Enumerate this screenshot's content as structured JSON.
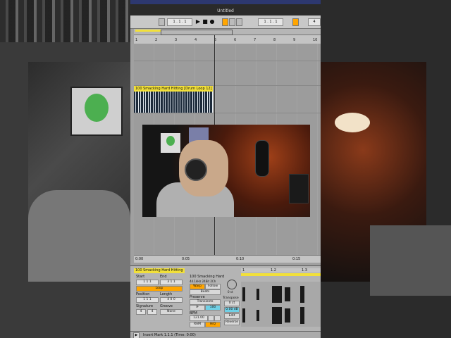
{
  "window": {
    "title": "Untitled"
  },
  "toolbar": {
    "arrangement_position": "1 . 1 . 1",
    "loop_start": "1 . 1 . 1",
    "loop_length": "4"
  },
  "ruler": {
    "ticks": [
      "1",
      "2",
      "3",
      "4",
      "5",
      "6",
      "7",
      "8",
      "9",
      "10"
    ]
  },
  "clip": {
    "name": "100 Smacking Hard Hitting [Drum Loop 12]"
  },
  "time_ruler": {
    "ticks": [
      "0:00",
      "0:05",
      "0:10",
      "0:15"
    ]
  },
  "clip_view": {
    "clip_name": "100 Smacking Hard Hitting",
    "sample_name": "100 Smacking Hard",
    "sample_info": "44.1kHz 24Bit 2Ch",
    "start_label": "Start",
    "end_label": "End",
    "start_value": "1  1  1",
    "end_value": "3  1  1",
    "loop_label": "Loop",
    "position_label": "Position",
    "length_label": "Length",
    "position_value": "1  1  1",
    "length_value": "4  0  0",
    "signature_label": "Signature",
    "groove_label": "Groove",
    "signature_num": "4",
    "signature_den": "4",
    "groove_value": "None",
    "warp_label": "Warp",
    "follow_label": "Follow",
    "warp_mode": "Beats",
    "preserve_label": "Preserve",
    "preserve_value": "Transients",
    "loop_mode": "⟳",
    "rate_value": "100",
    "bpm_label": "BPM",
    "bpm_value": "121.00",
    "ram_label": "RAM",
    "hiq_label": "HiQ",
    "transpose_label": "Transpose",
    "transpose_value": "0 st",
    "detune_value": "0 ct",
    "gain_value": "0.00 dB",
    "edit_label": "Edit",
    "reverse_label": "Reverse",
    "sample_ruler": [
      "1",
      "1.2",
      "1.3"
    ]
  },
  "status": {
    "text": "Insert Mark 1.1.1 (Time: 0:00)"
  }
}
